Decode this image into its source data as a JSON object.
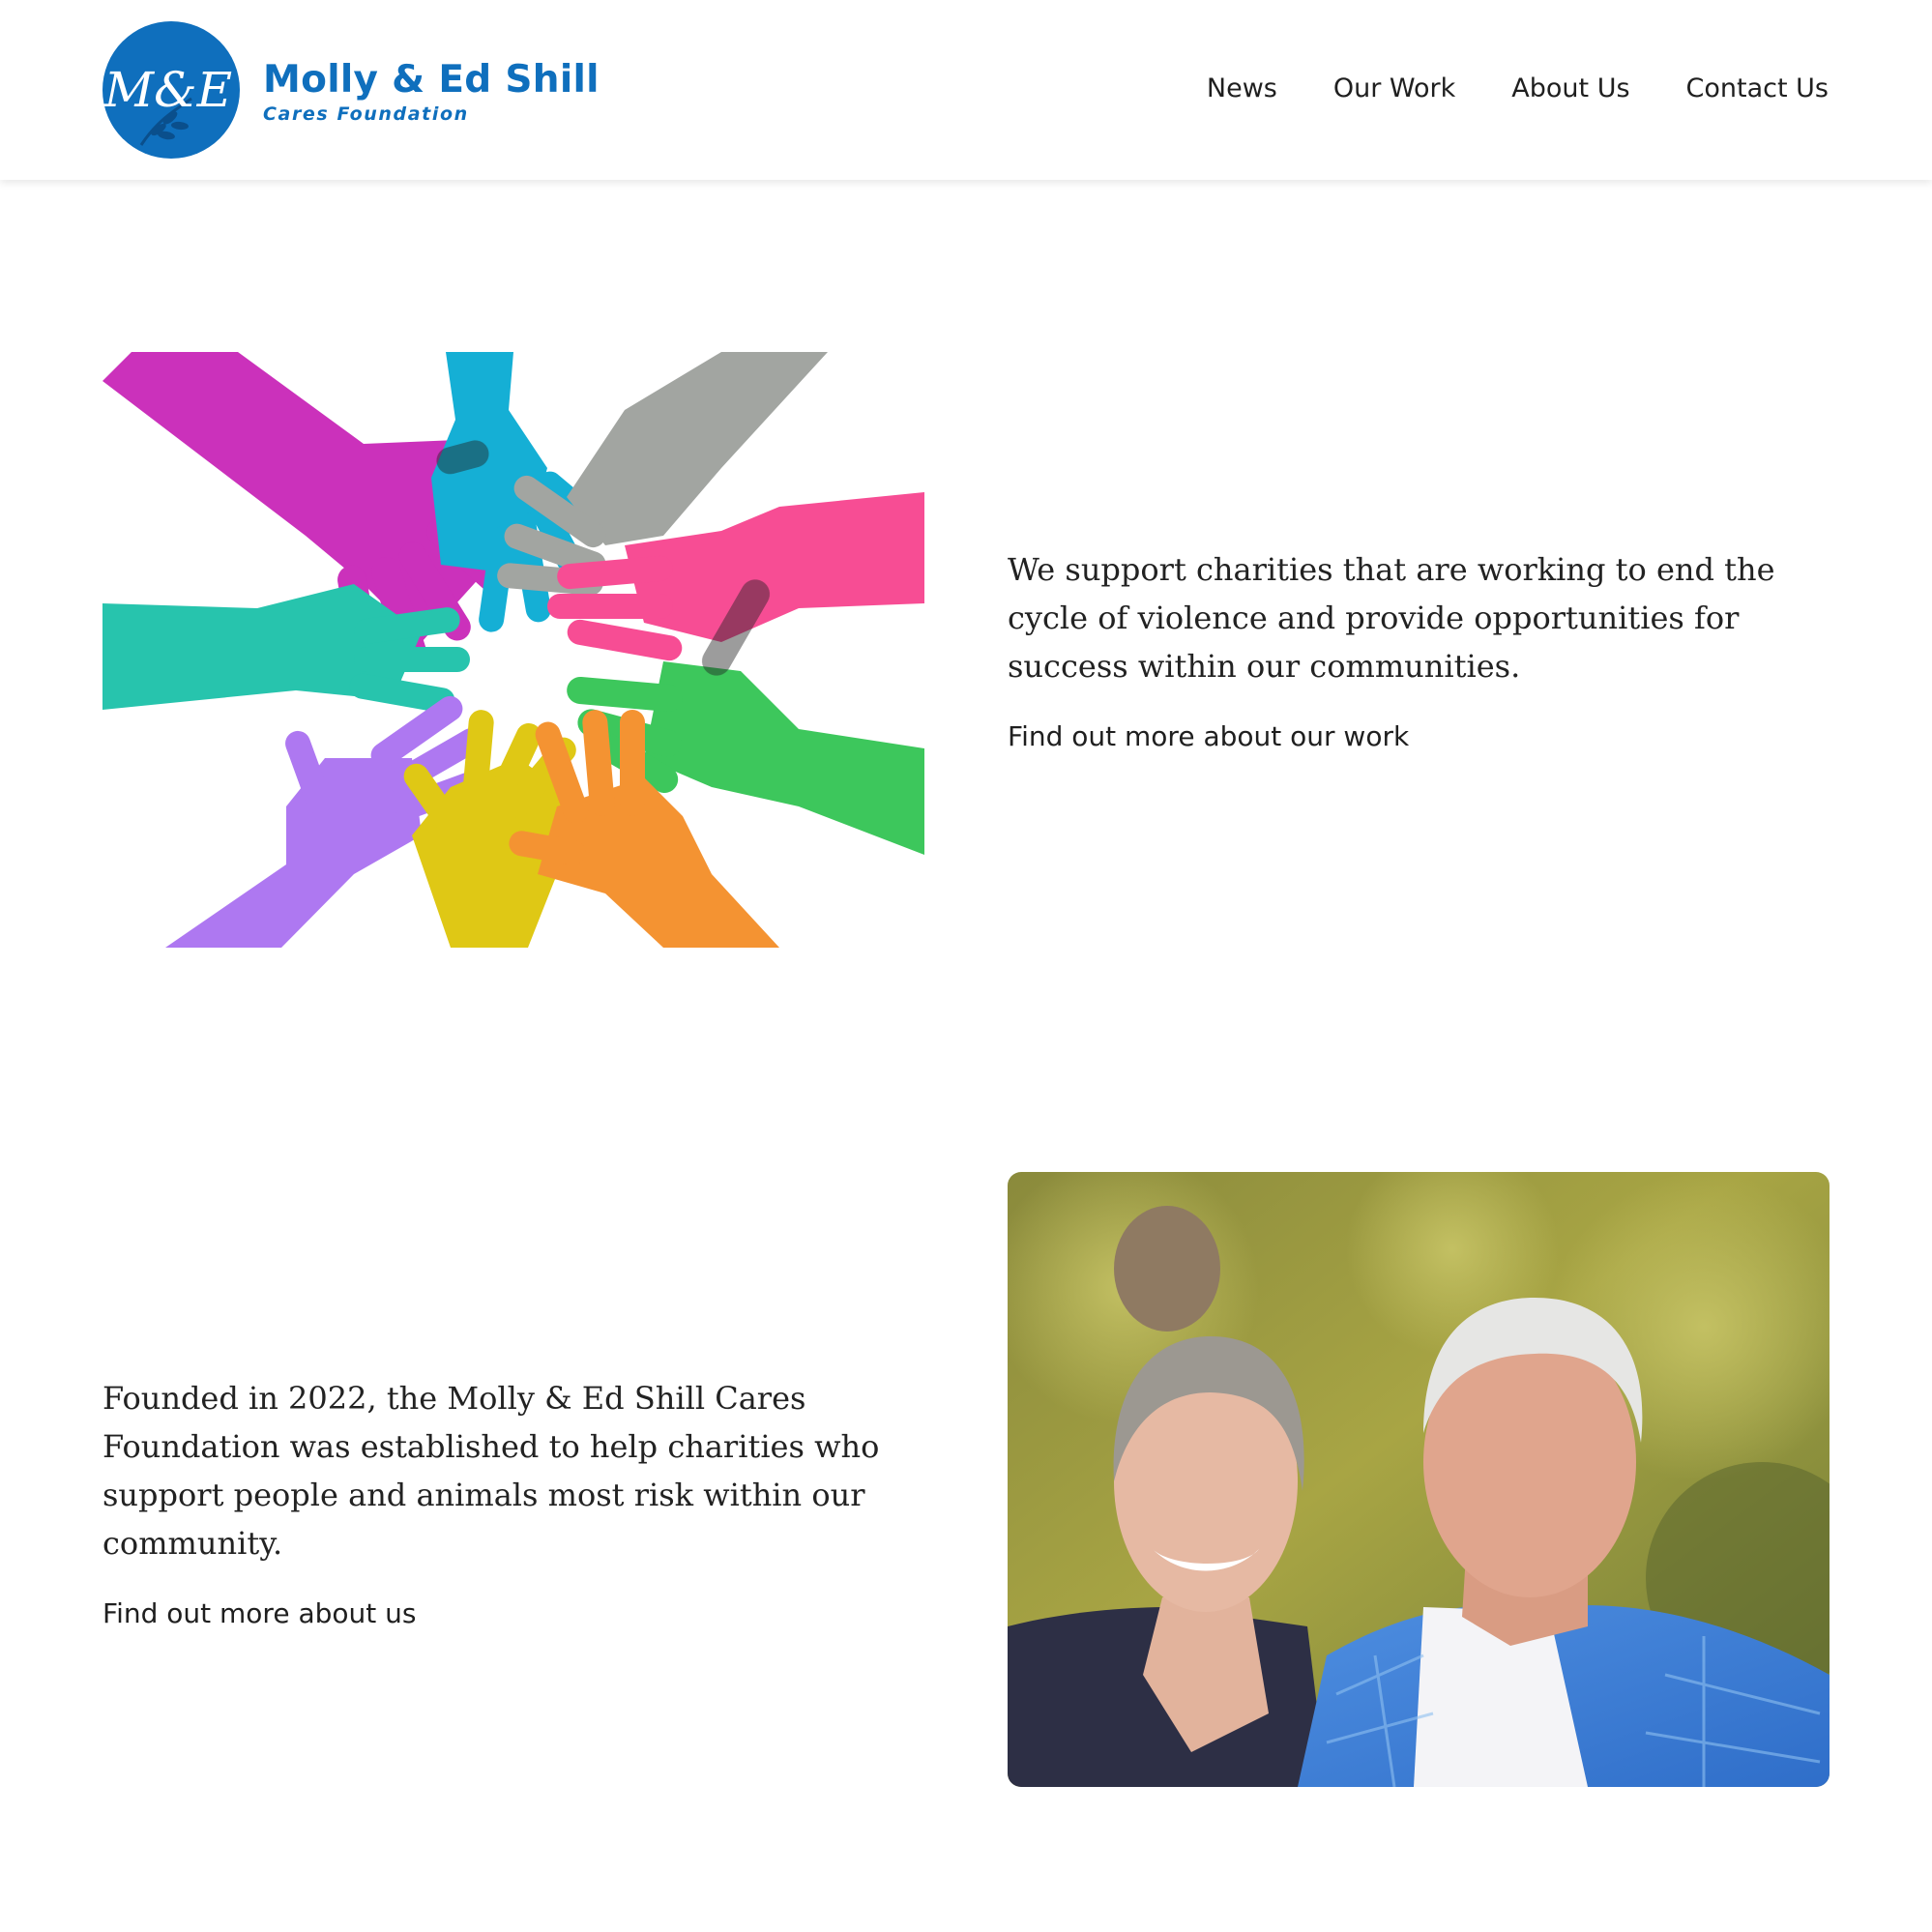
{
  "brand": {
    "monogram": "M&E",
    "name": "Molly & Ed Shill",
    "tagline": "Cares Foundation",
    "color": "#0f6fbd"
  },
  "nav": {
    "items": [
      {
        "label": "News"
      },
      {
        "label": "Our Work"
      },
      {
        "label": "About Us"
      },
      {
        "label": "Contact Us"
      }
    ]
  },
  "our_work": {
    "image_icon": "hands-together-illustration",
    "hand_colors": [
      "#c71fb5",
      "#00a8d2",
      "#9a9d99",
      "#f73e8b",
      "#14bfa6",
      "#2cc24e",
      "#a76cf0",
      "#ddc300",
      "#f48a20"
    ],
    "text": "We support charities that are working to end the cycle of violence and provide opportunities for success within our communities.",
    "link_label": "Find out more about our work"
  },
  "about": {
    "text": "Founded in 2022, the Molly & Ed Shill Cares Foundation was established to help charities who support people and animals most risk within our community.",
    "link_label": "Find out more about us",
    "photo_icon": "founders-portrait-photo"
  }
}
